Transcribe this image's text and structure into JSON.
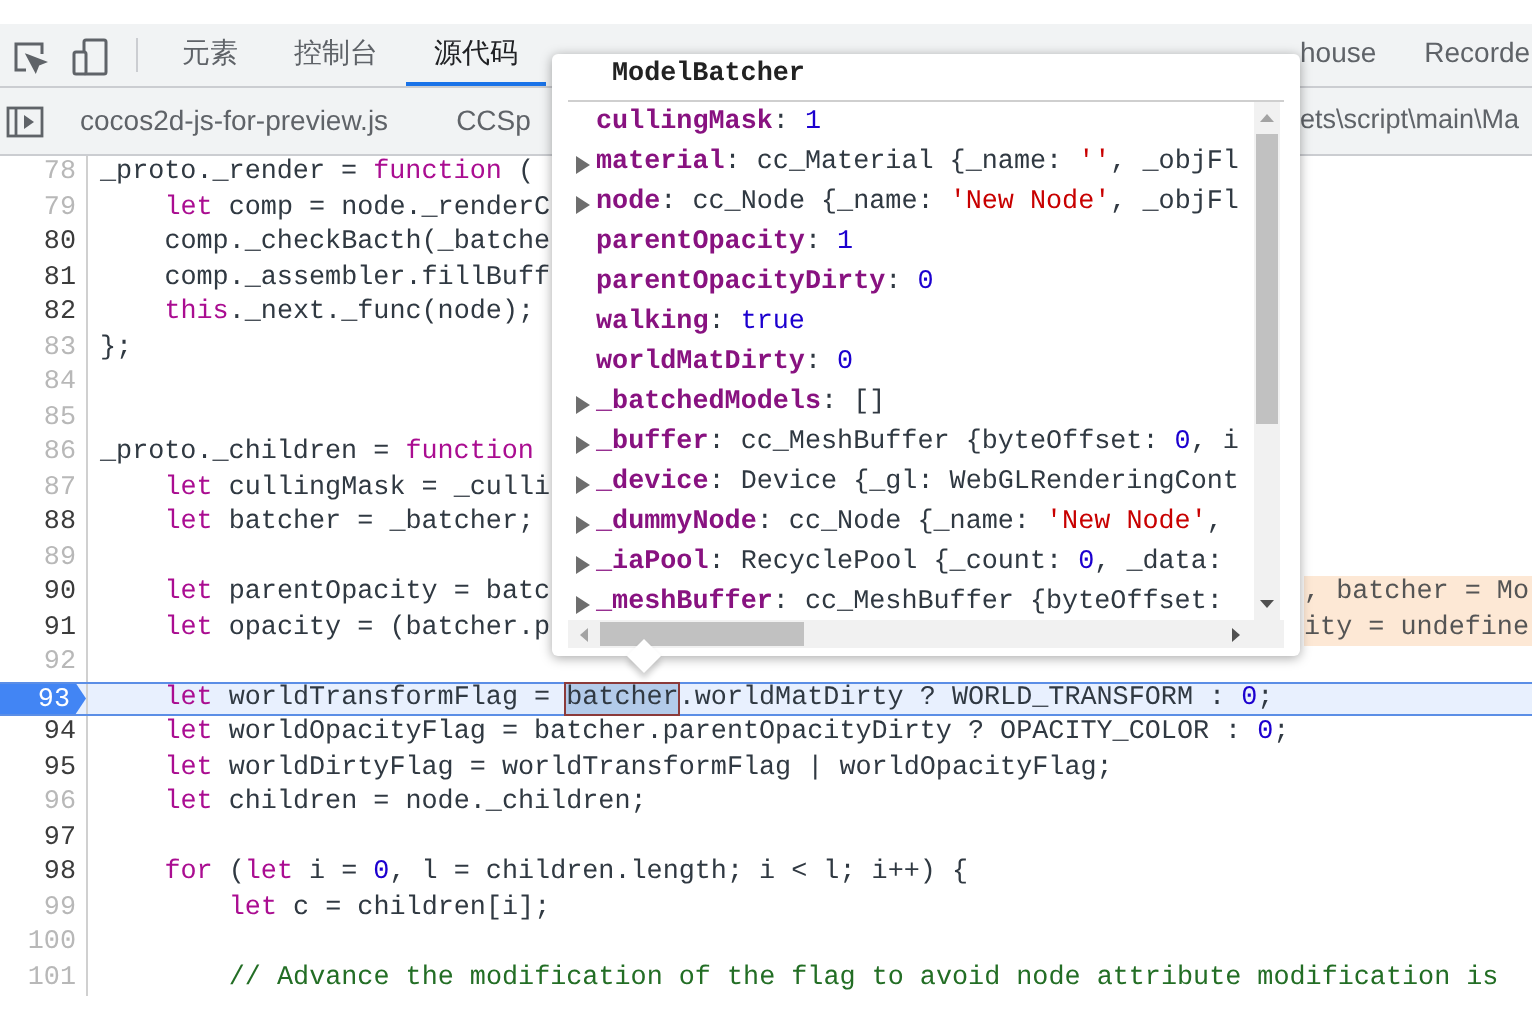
{
  "tabs": [
    {
      "label": "元素",
      "selected": false
    },
    {
      "label": "控制台",
      "selected": false
    },
    {
      "label": "源代码",
      "selected": true
    }
  ],
  "tabs_right": [
    {
      "label": "house",
      "selected": false
    },
    {
      "label": "Recorde",
      "selected": false
    }
  ],
  "file_tabs": [
    "cocos2d-js-for-preview.js",
    "CCSp"
  ],
  "file_path_right": "ets\\script\\main\\Ma",
  "code_lines": [
    {
      "number": "78",
      "dim": true,
      "kind": "top",
      "tokens": [
        {
          "kind": "plain",
          "text": "_proto._render = "
        },
        {
          "kind": "keyword",
          "text": "function"
        },
        {
          "kind": "plain",
          "text": " ("
        }
      ]
    },
    {
      "number": "79",
      "dim": true,
      "kind": "body",
      "tokens": [
        {
          "kind": "keyword",
          "text": "let"
        },
        {
          "kind": "plain",
          "text": " comp = node._renderC"
        }
      ]
    },
    {
      "number": "80",
      "dim": false,
      "kind": "body",
      "tokens": [
        {
          "kind": "plain",
          "text": "comp._checkBacth(_batche"
        }
      ]
    },
    {
      "number": "81",
      "dim": false,
      "kind": "body",
      "tokens": [
        {
          "kind": "plain",
          "text": "comp._assembler.fillBuff"
        }
      ]
    },
    {
      "number": "82",
      "dim": false,
      "kind": "body",
      "tokens": [
        {
          "kind": "keyword",
          "text": "this"
        },
        {
          "kind": "plain",
          "text": "._next._func(node);"
        }
      ]
    },
    {
      "number": "83",
      "dim": true,
      "kind": "top",
      "tokens": [
        {
          "kind": "plain",
          "text": "};"
        }
      ]
    },
    {
      "number": "84",
      "dim": true
    },
    {
      "number": "85",
      "dim": true
    },
    {
      "number": "86",
      "dim": true,
      "kind": "top",
      "tokens": [
        {
          "kind": "plain",
          "text": "_proto._children = "
        },
        {
          "kind": "keyword",
          "text": "function"
        }
      ]
    },
    {
      "number": "87",
      "dim": true,
      "kind": "body",
      "tokens": [
        {
          "kind": "keyword",
          "text": "let"
        },
        {
          "kind": "plain",
          "text": " cullingMask = _culli"
        }
      ]
    },
    {
      "number": "88",
      "dim": false,
      "kind": "body",
      "tokens": [
        {
          "kind": "keyword",
          "text": "let"
        },
        {
          "kind": "plain",
          "text": " batcher = _batcher;"
        }
      ]
    },
    {
      "number": "89",
      "dim": true
    },
    {
      "number": "90",
      "dim": false,
      "kind": "body",
      "tokens": [
        {
          "kind": "keyword",
          "text": "let"
        },
        {
          "kind": "plain",
          "text": " parentOpacity = batc"
        }
      ],
      "tail": ", batcher = Mo"
    },
    {
      "number": "91",
      "dim": false,
      "kind": "body",
      "tokens": [
        {
          "kind": "keyword",
          "text": "let"
        },
        {
          "kind": "plain",
          "text": " opacity = (batcher.p"
        }
      ],
      "tail": "ity = undefine"
    },
    {
      "number": "92",
      "dim": true
    },
    {
      "number": "93",
      "current": true,
      "kind": "body",
      "tokens": [
        {
          "kind": "keyword",
          "text": "let"
        },
        {
          "kind": "plain",
          "text": " worldTransformFlag = "
        },
        {
          "kind": "selected",
          "text": "batcher"
        },
        {
          "kind": "plain",
          "text": ".worldMatDirty ? WORLD_TRANSFORM : "
        },
        {
          "kind": "number",
          "text": "0"
        },
        {
          "kind": "plain",
          "text": ";"
        }
      ]
    },
    {
      "number": "94",
      "dim": false,
      "kind": "body",
      "tokens": [
        {
          "kind": "keyword",
          "text": "let"
        },
        {
          "kind": "plain",
          "text": " worldOpacityFlag = batcher.parentOpacityDirty ? OPACITY_COLOR : "
        },
        {
          "kind": "number",
          "text": "0"
        },
        {
          "kind": "plain",
          "text": ";"
        }
      ]
    },
    {
      "number": "95",
      "dim": false,
      "kind": "body",
      "tokens": [
        {
          "kind": "keyword",
          "text": "let"
        },
        {
          "kind": "plain",
          "text": " worldDirtyFlag = worldTransformFlag | worldOpacityFlag;"
        }
      ]
    },
    {
      "number": "96",
      "dim": true,
      "kind": "body",
      "tokens": [
        {
          "kind": "keyword",
          "text": "let"
        },
        {
          "kind": "plain",
          "text": " children = node._children;"
        }
      ]
    },
    {
      "number": "97",
      "dim": false
    },
    {
      "number": "98",
      "dim": false,
      "kind": "body",
      "tokens": [
        {
          "kind": "keyword",
          "text": "for"
        },
        {
          "kind": "plain",
          "text": " ("
        },
        {
          "kind": "keyword",
          "text": "let"
        },
        {
          "kind": "plain",
          "text": " i = "
        },
        {
          "kind": "number",
          "text": "0"
        },
        {
          "kind": "plain",
          "text": ", l = children.length; i < l; i++) {"
        }
      ]
    },
    {
      "number": "99",
      "dim": true,
      "kind": "inner",
      "tokens": [
        {
          "kind": "keyword",
          "text": "let"
        },
        {
          "kind": "plain",
          "text": " c = children[i];"
        }
      ]
    },
    {
      "number": "100",
      "dim": true
    },
    {
      "number": "101",
      "dim": true,
      "kind": "inner",
      "tokens": [
        {
          "kind": "comment",
          "text": "// Advance the modification of the flag to avoid node attribute modification is"
        }
      ]
    }
  ],
  "popover": {
    "title": "ModelBatcher",
    "properties": [
      {
        "key": "cullingMask",
        "expandable": false,
        "value": [
          {
            "kind": "plain",
            "text": ": "
          },
          {
            "kind": "number",
            "text": "1"
          }
        ]
      },
      {
        "key": "material",
        "expandable": true,
        "value": [
          {
            "kind": "plain",
            "text": ": cc_Material {_name: "
          },
          {
            "kind": "string",
            "text": "''"
          },
          {
            "kind": "plain",
            "text": ", _objFl"
          }
        ]
      },
      {
        "key": "node",
        "expandable": true,
        "value": [
          {
            "kind": "plain",
            "text": ": cc_Node {_name: "
          },
          {
            "kind": "string",
            "text": "'New Node'"
          },
          {
            "kind": "plain",
            "text": ", _objFl"
          }
        ]
      },
      {
        "key": "parentOpacity",
        "expandable": false,
        "value": [
          {
            "kind": "plain",
            "text": ": "
          },
          {
            "kind": "number",
            "text": "1"
          }
        ]
      },
      {
        "key": "parentOpacityDirty",
        "expandable": false,
        "value": [
          {
            "kind": "plain",
            "text": ": "
          },
          {
            "kind": "number",
            "text": "0"
          }
        ]
      },
      {
        "key": "walking",
        "expandable": false,
        "value": [
          {
            "kind": "plain",
            "text": ": "
          },
          {
            "kind": "number",
            "text": "true"
          }
        ]
      },
      {
        "key": "worldMatDirty",
        "expandable": false,
        "value": [
          {
            "kind": "plain",
            "text": ": "
          },
          {
            "kind": "number",
            "text": "0"
          }
        ]
      },
      {
        "key": "_batchedModels",
        "expandable": true,
        "value": [
          {
            "kind": "plain",
            "text": ": []"
          }
        ]
      },
      {
        "key": "_buffer",
        "expandable": true,
        "value": [
          {
            "kind": "plain",
            "text": ": cc_MeshBuffer {byteOffset: "
          },
          {
            "kind": "number",
            "text": "0"
          },
          {
            "kind": "plain",
            "text": ", i"
          }
        ]
      },
      {
        "key": "_device",
        "expandable": true,
        "value": [
          {
            "kind": "plain",
            "text": ": Device {_gl: WebGLRenderingCont"
          }
        ]
      },
      {
        "key": "_dummyNode",
        "expandable": true,
        "value": [
          {
            "kind": "plain",
            "text": ": cc_Node {_name: "
          },
          {
            "kind": "string",
            "text": "'New Node'"
          },
          {
            "kind": "plain",
            "text": ","
          }
        ]
      },
      {
        "key": "_iaPool",
        "expandable": true,
        "value": [
          {
            "kind": "plain",
            "text": ": RecyclePool {_count: "
          },
          {
            "kind": "number",
            "text": "0"
          },
          {
            "kind": "plain",
            "text": ", _data:"
          }
        ]
      },
      {
        "key": "_meshBuffer",
        "expandable": true,
        "value": [
          {
            "kind": "plain",
            "text": ": cc_MeshBuffer {byteOffset:"
          }
        ]
      }
    ]
  }
}
